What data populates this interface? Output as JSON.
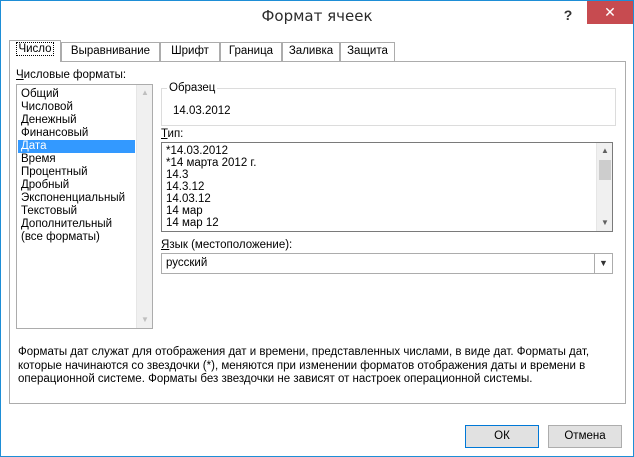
{
  "window": {
    "title": "Формат ячеек",
    "help_label": "?",
    "close_label": "✕"
  },
  "tabs": [
    {
      "label": "Число",
      "active": true
    },
    {
      "label": "Выравнивание"
    },
    {
      "label": "Шрифт"
    },
    {
      "label": "Граница"
    },
    {
      "label": "Заливка"
    },
    {
      "label": "Защита"
    }
  ],
  "number_formats": {
    "label_u": "Ч",
    "label_rest": "исловые форматы:",
    "items": [
      "Общий",
      "Числовой",
      "Денежный",
      "Финансовый",
      "Дата",
      "Время",
      "Процентный",
      "Дробный",
      "Экспоненциальный",
      "Текстовый",
      "Дополнительный",
      "(все форматы)"
    ],
    "selected": "Дата"
  },
  "sample": {
    "title": "Образец",
    "value": "14.03.2012"
  },
  "type": {
    "label_u": "Т",
    "label_rest": "ип:",
    "items": [
      "*14.03.2012",
      "*14 марта 2012 г.",
      "14.3",
      "14.3.12",
      "14.03.12",
      "14 мар",
      "14 мар 12"
    ],
    "selected": "*14.03.2012"
  },
  "locale": {
    "label_u": "Я",
    "label_rest": "зык (местоположение):",
    "value": "русский"
  },
  "description": "Форматы дат служат для отображения дат и времени, представленных числами, в виде дат. Форматы дат, которые начинаются со звездочки (*), меняются при изменении форматов отображения даты и времени в операционной системе. Форматы без звездочки не зависят от настроек операционной системы.",
  "buttons": {
    "ok": "ОК",
    "cancel": "Отмена"
  },
  "colors": {
    "selection": "#3399ff",
    "close_button": "#c74b50",
    "window_border": "#1e8ed6"
  }
}
